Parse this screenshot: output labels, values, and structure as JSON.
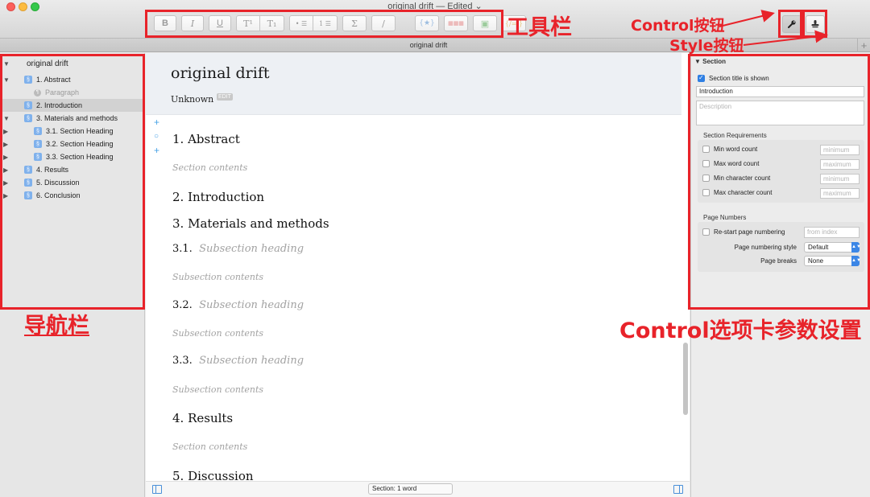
{
  "window": {
    "title": "original drift — Edited ⌄",
    "tab_label": "original drift",
    "new_tab": "+"
  },
  "toolbar": {
    "bold": "B",
    "italic": "I",
    "underline": "U",
    "superscript": "T¹",
    "subscript": "T₁",
    "bullet_list": "• ☰",
    "number_list": "1 ☰",
    "equation": "Σ",
    "slash": "/",
    "citation": "{★}",
    "table": "▦▦▦",
    "image": "▣",
    "code": "{/=/}"
  },
  "navigator": {
    "document_title": "original drift",
    "items": [
      {
        "label": "1. Abstract",
        "type": "section",
        "expanded": true
      },
      {
        "label": "Paragraph",
        "type": "paragraph"
      },
      {
        "label": "2. Introduction",
        "type": "section",
        "selected": true
      },
      {
        "label": "3. Materials and methods",
        "type": "section",
        "expanded": true
      },
      {
        "label": "3.1. Section Heading",
        "type": "section"
      },
      {
        "label": "3.2. Section Heading",
        "type": "section"
      },
      {
        "label": "3.3. Section Heading",
        "type": "section"
      },
      {
        "label": "4. Results",
        "type": "section"
      },
      {
        "label": "5. Discussion",
        "type": "section"
      },
      {
        "label": "6. Conclusion",
        "type": "section"
      }
    ]
  },
  "editor": {
    "title": "original drift",
    "author": "Unknown",
    "edit_tag": "EDIT",
    "gutter": [
      "+",
      "○",
      "+"
    ],
    "blocks": {
      "h1_abstract": "1.  Abstract",
      "p_abstract": "Section contents",
      "h1_intro": "2.  Introduction",
      "h1_methods": "3.  Materials and methods",
      "h2_31_num": "3.1.",
      "h2_31_text": "Subsection heading",
      "p_31": "Subsection contents",
      "h2_32_num": "3.2.",
      "h2_32_text": "Subsection heading",
      "p_32": "Subsection contents",
      "h2_33_num": "3.3.",
      "h2_33_text": "Subsection heading",
      "p_33": "Subsection contents",
      "h1_results": "4.  Results",
      "p_results": "Section contents",
      "h1_discussion": "5.  Discussion"
    },
    "status": "Section: 1 word"
  },
  "inspector": {
    "header": "▼ Section",
    "title_shown_label": "Section title is shown",
    "title_value": "Introduction",
    "description_placeholder": "Description",
    "requirements_title": "Section Requirements",
    "min_word": "Min word count",
    "max_word": "Max word count",
    "min_char": "Min character count",
    "max_char": "Max character count",
    "ph_minimum": "minimum",
    "ph_maximum": "maximum",
    "page_numbers_title": "Page Numbers",
    "restart_label": "Re-start page numbering",
    "from_index_ph": "from index",
    "numbering_style_label": "Page numbering style",
    "numbering_style_value": "Default",
    "page_breaks_label": "Page breaks",
    "page_breaks_value": "None"
  },
  "annotations": {
    "toolbar": "工具栏",
    "control_button": "Control按钮",
    "style_button": "Style按钮",
    "navigator": "导航栏",
    "control_tab": "Control选项卡参数设置"
  },
  "colors": {
    "annotation_red": "#e8232a",
    "accent_blue": "#2f7fe3"
  }
}
